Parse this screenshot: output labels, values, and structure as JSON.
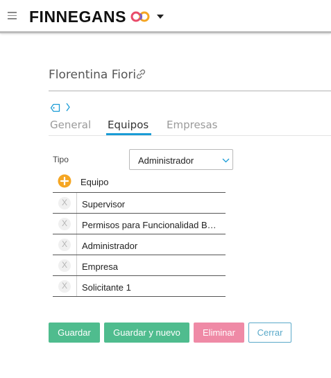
{
  "header": {
    "brand": "FINNEGANS",
    "menu_icon": "hamburger-menu-icon",
    "logo_mark_icon": "finnegans-co-logo-icon",
    "caret_icon": "caret-down-icon"
  },
  "record": {
    "title": "Florentina Fiori",
    "link_icon": "link-icon",
    "tag_icon": "tag-icon",
    "chevron_icon": "chevron-right-icon"
  },
  "tabs": [
    {
      "label": "General",
      "active": false
    },
    {
      "label": "Equipos",
      "active": true
    },
    {
      "label": "Empresas",
      "active": false
    }
  ],
  "form": {
    "tipo_label": "Tipo",
    "tipo_value": "Administrador"
  },
  "table": {
    "header": "Equipo",
    "remove_label": "X",
    "rows": [
      "Supervisor",
      "Permisos para Funcionalidad B…",
      "Administrador",
      "Empresa",
      "Solicitante 1"
    ]
  },
  "buttons": {
    "save": "Guardar",
    "save_new": "Guardar y nuevo",
    "delete": "Eliminar",
    "close": "Cerrar"
  },
  "colors": {
    "accent_tab": "#1a9cd6",
    "save_green": "#4fbc8e",
    "delete_pink": "#ef8aa6",
    "close_blue": "#5aa9c9",
    "add_orange": "#f5a623"
  }
}
